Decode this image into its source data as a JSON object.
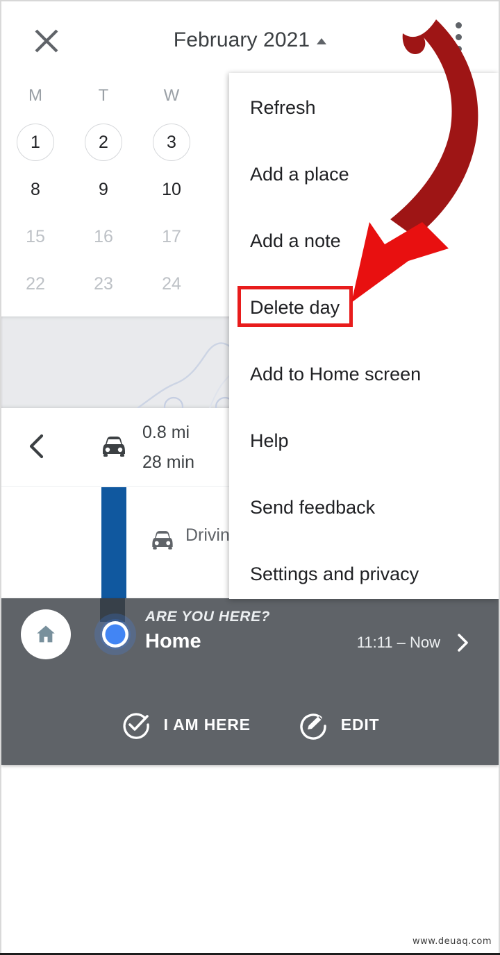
{
  "appbar": {
    "close_icon": "close-icon",
    "title": "February 2021",
    "caret_icon": "caret-up-icon",
    "overflow_icon": "overflow-menu-icon"
  },
  "calendar": {
    "day_headers": [
      "M",
      "T",
      "W"
    ],
    "weeks": [
      {
        "days": [
          "1",
          "2",
          "3"
        ],
        "style": "ringed"
      },
      {
        "days": [
          "8",
          "9",
          "10"
        ],
        "style": "normal"
      },
      {
        "days": [
          "15",
          "16",
          "17"
        ],
        "style": "dim"
      },
      {
        "days": [
          "22",
          "23",
          "24"
        ],
        "style": "dim"
      }
    ]
  },
  "map": {
    "name": "map-thumbnail",
    "background_color": "#e9eaed",
    "route_color": "#c2cbe0"
  },
  "route_summary": {
    "back_icon": "chevron-left-icon",
    "vehicle_icon": "car-icon",
    "distance": "0.8 mi",
    "duration": "28 min"
  },
  "driving_row": {
    "bar_color": "#10589f",
    "vehicle_icon": "car-icon",
    "label": "Driving"
  },
  "are_you_here": {
    "home_icon": "home-icon",
    "location_dot_icon": "location-dot-icon",
    "prompt": "ARE YOU HERE?",
    "place": "Home",
    "time_range": "11:11 – Now",
    "chevron_icon": "chevron-right-icon",
    "actions": [
      {
        "icon": "check-circle-icon",
        "label": "I AM HERE"
      },
      {
        "icon": "edit-circle-icon",
        "label": "EDIT"
      }
    ],
    "background_color": "#5f6368"
  },
  "overflow_menu": {
    "items": [
      {
        "label": "Refresh"
      },
      {
        "label": "Add a place"
      },
      {
        "label": "Add a note"
      },
      {
        "label": "Delete day"
      },
      {
        "label": "Add to Home screen"
      },
      {
        "label": "Help"
      },
      {
        "label": "Send feedback"
      },
      {
        "label": "Settings and privacy"
      }
    ]
  },
  "annotation": {
    "highlight_target": "Delete day",
    "highlight_color": "#e81c1c",
    "arrow_tail_color": "#9e1515",
    "arrow_head_color": "#e81010"
  },
  "watermark": {
    "text": "www.deuaq.com"
  }
}
